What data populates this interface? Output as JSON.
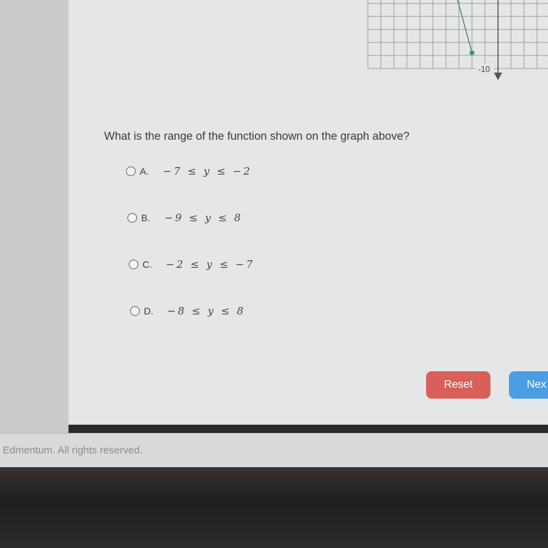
{
  "graph": {
    "axis_label": "-10",
    "point_color": "#3a9a5a",
    "line_color": "#4a7a6a"
  },
  "question": "What is the range of the function shown on the graph above?",
  "options": [
    {
      "letter": "A.",
      "text": "−7 ≤ y ≤ −2"
    },
    {
      "letter": "B.",
      "text": "−9 ≤ y ≤ 8"
    },
    {
      "letter": "C.",
      "text": "−2 ≤ y ≤ −7"
    },
    {
      "letter": "D.",
      "text": "−8 ≤ y ≤ 8"
    }
  ],
  "buttons": {
    "reset": "Reset",
    "next": "Nex"
  },
  "footer": "Edmentum. All rights reserved.",
  "colors": {
    "reset": "#d9605a",
    "next": "#4a9ee3"
  }
}
